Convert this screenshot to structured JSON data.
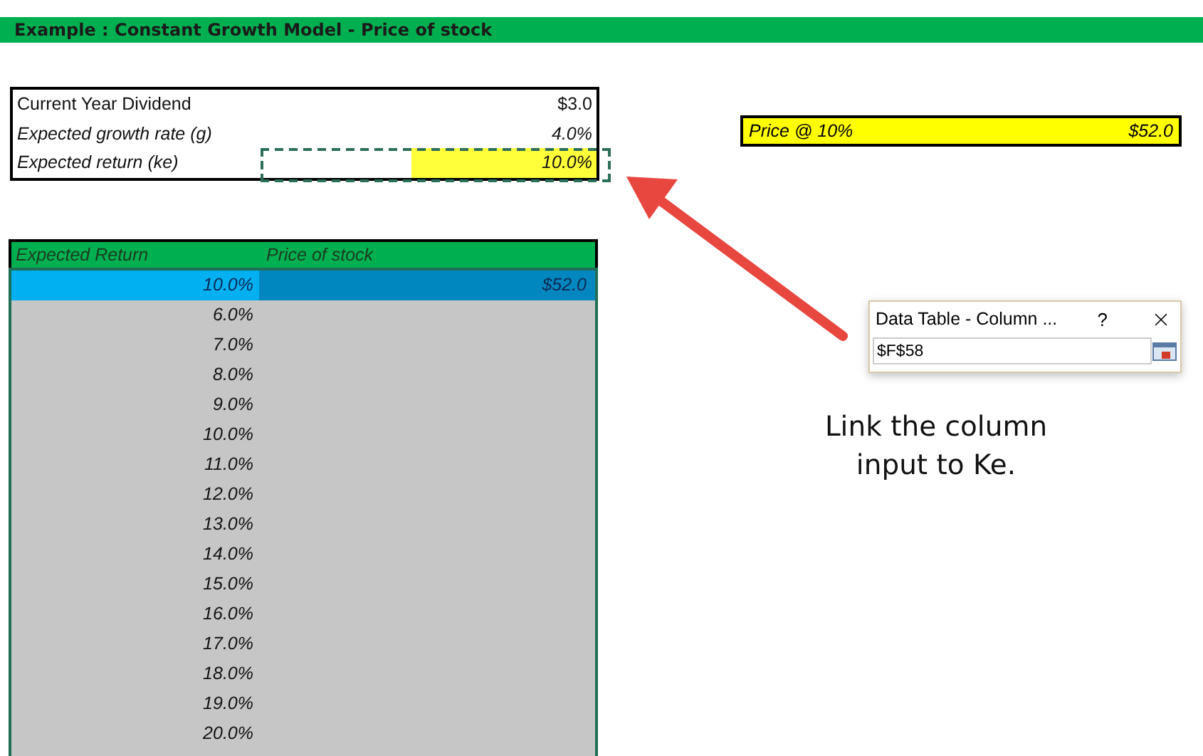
{
  "title": "Example : Constant Growth Model - Price of stock",
  "inputs": [
    {
      "label": "Current Year Dividend",
      "value": "$3.0",
      "italic": false,
      "linked": false
    },
    {
      "label": "Expected growth rate (g)",
      "value": "4.0%",
      "italic": true,
      "linked": false
    },
    {
      "label": "Expected return (ke)",
      "value": "10.0%",
      "italic": true,
      "linked": true
    }
  ],
  "price_box": {
    "label": "Price @ 10%",
    "value": "$52.0"
  },
  "table": {
    "columns": [
      "Expected Return",
      "Price of stock"
    ],
    "rows": [
      {
        "cells": [
          "10.0%",
          "$52.0"
        ],
        "selected": true
      },
      {
        "cells": [
          "6.0%"
        ],
        "selected": false
      },
      {
        "cells": [
          "7.0%"
        ],
        "selected": false
      },
      {
        "cells": [
          "8.0%"
        ],
        "selected": false
      },
      {
        "cells": [
          "9.0%"
        ],
        "selected": false
      },
      {
        "cells": [
          "10.0%"
        ],
        "selected": false
      },
      {
        "cells": [
          "11.0%"
        ],
        "selected": false
      },
      {
        "cells": [
          "12.0%"
        ],
        "selected": false
      },
      {
        "cells": [
          "13.0%"
        ],
        "selected": false
      },
      {
        "cells": [
          "14.0%"
        ],
        "selected": false
      },
      {
        "cells": [
          "15.0%"
        ],
        "selected": false
      },
      {
        "cells": [
          "16.0%"
        ],
        "selected": false
      },
      {
        "cells": [
          "17.0%"
        ],
        "selected": false
      },
      {
        "cells": [
          "18.0%"
        ],
        "selected": false
      },
      {
        "cells": [
          "19.0%"
        ],
        "selected": false
      },
      {
        "cells": [
          "20.0%"
        ],
        "selected": false
      }
    ]
  },
  "dialog": {
    "title": "Data Table - Column ...",
    "help": "?",
    "input": "$F$58"
  },
  "note": "Link the column input to Ke."
}
